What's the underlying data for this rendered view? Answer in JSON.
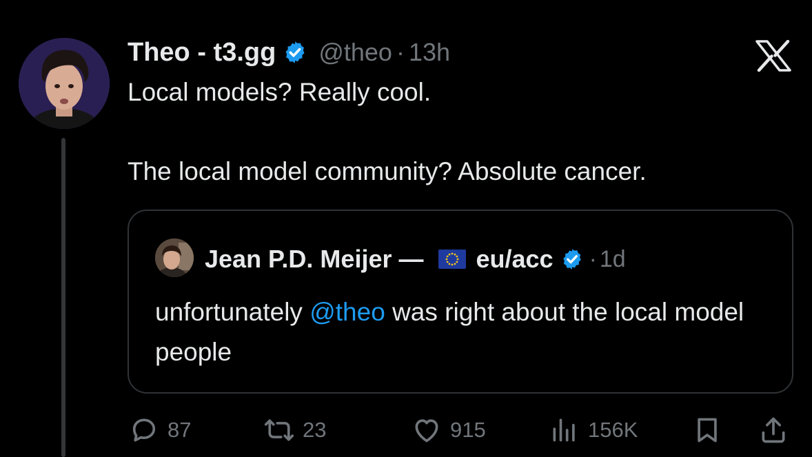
{
  "tweet": {
    "author": {
      "name": "Theo - t3.gg",
      "handle": "@theo",
      "separator": "·",
      "time": "13h"
    },
    "text_line_1": "Local models? Really cool.",
    "text_line_2": "The local model community? Absolute cancer.",
    "quote": {
      "author_name": "Jean P.D. Meijer —",
      "author_suffix": "eu/acc",
      "separator": "·",
      "time": "1d",
      "text_before": "unfortunately ",
      "mention": "@theo",
      "text_after": " was right about the local model people"
    },
    "actions": {
      "replies": "87",
      "reposts": "23",
      "likes": "915",
      "views": "156K"
    }
  },
  "icons": {
    "close": "x-logo-icon",
    "verified": "verified-badge-icon",
    "flag": "eu-flag-icon",
    "reply": "reply-icon",
    "repost": "repost-icon",
    "like": "heart-icon",
    "views": "views-icon",
    "bookmark": "bookmark-icon",
    "share": "share-icon"
  },
  "colors": {
    "background": "#000000",
    "text": "#e7e9ea",
    "secondary": "#71767b",
    "accent": "#1d9bf0",
    "border": "#2f3336"
  }
}
